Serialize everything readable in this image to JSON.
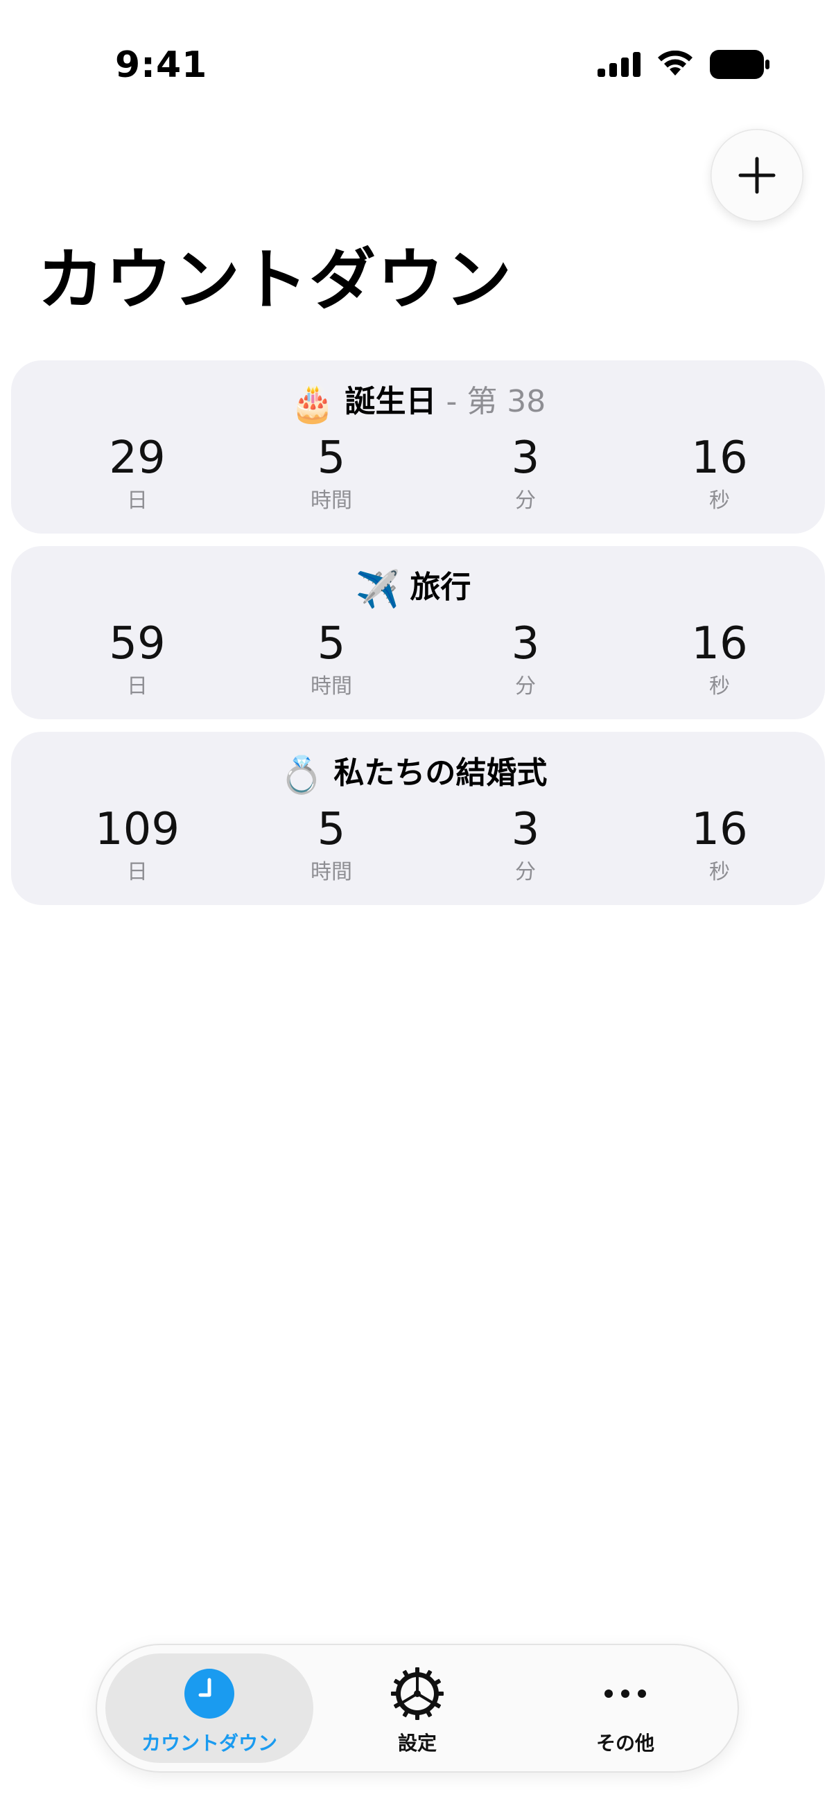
{
  "status_bar": {
    "time": "9:41"
  },
  "header": {
    "title": "カウントダウン",
    "add_icon": "plus-icon"
  },
  "countdowns": [
    {
      "emoji": "🎂",
      "name": "誕生日",
      "suffix": "- 第 38",
      "days": "29",
      "hours": "5",
      "minutes": "3",
      "seconds": "16"
    },
    {
      "emoji": "✈️",
      "name": "旅行",
      "suffix": "",
      "days": "59",
      "hours": "5",
      "minutes": "3",
      "seconds": "16"
    },
    {
      "emoji": "💍",
      "name": "私たちの結婚式",
      "suffix": "",
      "days": "109",
      "hours": "5",
      "minutes": "3",
      "seconds": "16"
    }
  ],
  "units": {
    "days": "日",
    "hours": "時間",
    "minutes": "分",
    "seconds": "秒"
  },
  "tab_bar": {
    "tabs": [
      {
        "label": "カウントダウン",
        "icon": "clock-icon",
        "active": true
      },
      {
        "label": "設定",
        "icon": "gear-icon",
        "active": false
      },
      {
        "label": "その他",
        "icon": "more-icon",
        "active": false
      }
    ]
  },
  "colors": {
    "accent": "#1a9bf0",
    "card_bg": "#f1f1f6",
    "secondary_text": "#8e8e93"
  }
}
